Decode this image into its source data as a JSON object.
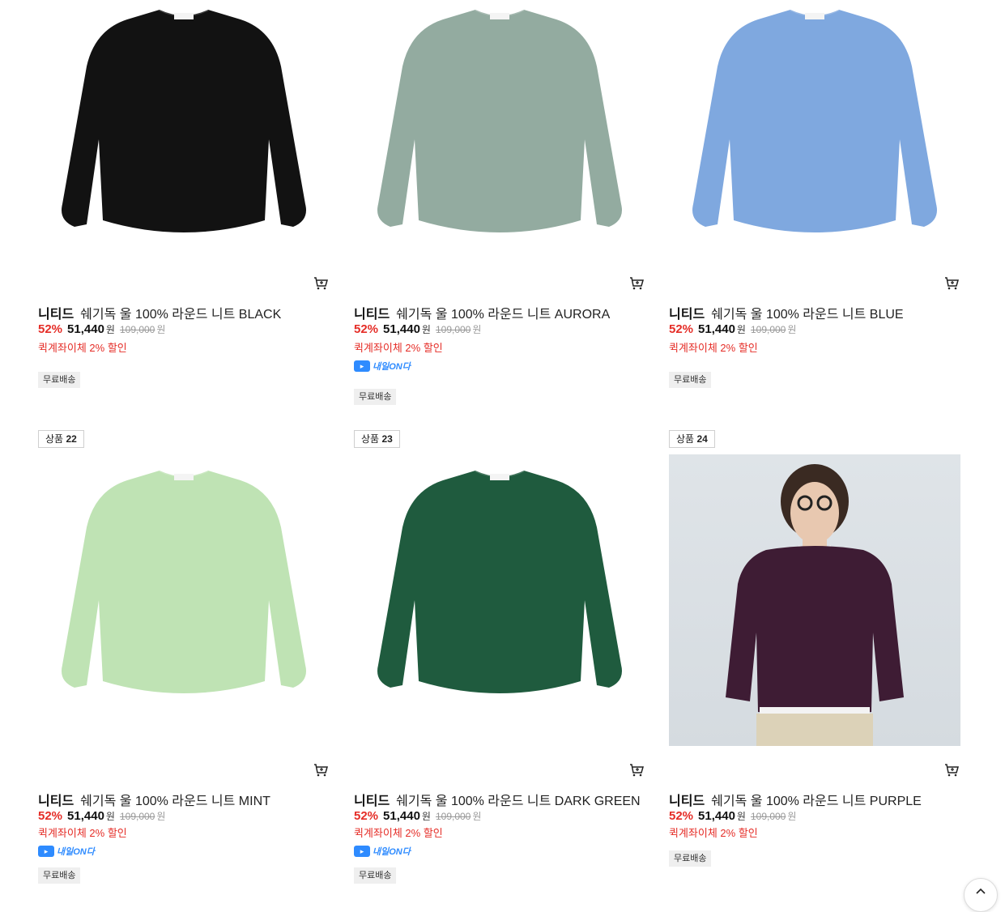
{
  "top_button": {
    "icon": "arrow-up-icon"
  },
  "products": [
    {
      "brand": "니티드",
      "name": "쉐기독 울 100% 라운드 니트 BLACK",
      "discount": "52%",
      "price": "51,440",
      "currency": "원",
      "original_price": "109,000",
      "promo": "퀵계좌이체 2% 할인",
      "badges": [
        "무료배송"
      ],
      "naeil": false,
      "tag": null,
      "sweater_color": "#121212",
      "cart_icon": "cart-icon"
    },
    {
      "brand": "니티드",
      "name": "쉐기독 울 100% 라운드 니트 AURORA",
      "discount": "52%",
      "price": "51,440",
      "currency": "원",
      "original_price": "109,000",
      "promo": "퀵계좌이체 2% 할인",
      "badges": [
        "무료배송"
      ],
      "naeil": true,
      "naeil_label": "내일ON다",
      "tag": null,
      "sweater_color": "#93aba0",
      "cart_icon": "cart-icon"
    },
    {
      "brand": "니티드",
      "name": "쉐기독 울 100% 라운드 니트 BLUE",
      "discount": "52%",
      "price": "51,440",
      "currency": "원",
      "original_price": "109,000",
      "promo": "퀵계좌이체 2% 할인",
      "badges": [
        "무료배송"
      ],
      "naeil": false,
      "tag": null,
      "sweater_color": "#7fa8df",
      "cart_icon": "cart-icon"
    },
    {
      "brand": "니티드",
      "name": "쉐기독 울 100% 라운드 니트 MINT",
      "discount": "52%",
      "price": "51,440",
      "currency": "원",
      "original_price": "109,000",
      "promo": "퀵계좌이체 2% 할인",
      "badges": [
        "무료배송"
      ],
      "naeil": true,
      "naeil_label": "내일ON다",
      "tag_label": "상품",
      "tag_num": "22",
      "sweater_color": "#bfe3b4",
      "cart_icon": "cart-icon"
    },
    {
      "brand": "니티드",
      "name": "쉐기독 울 100% 라운드 니트 DARK GREEN",
      "discount": "52%",
      "price": "51,440",
      "currency": "원",
      "original_price": "109,000",
      "promo": "퀵계좌이체 2% 할인",
      "badges": [
        "무료배송"
      ],
      "naeil": true,
      "naeil_label": "내일ON다",
      "tag_label": "상품",
      "tag_num": "23",
      "sweater_color": "#1f5b3e",
      "cart_icon": "cart-icon"
    },
    {
      "brand": "니티드",
      "name": "쉐기독 울 100% 라운드 니트 PURPLE",
      "discount": "52%",
      "price": "51,440",
      "currency": "원",
      "original_price": "109,000",
      "promo": "퀵계좌이체 2% 할인",
      "badges": [
        "무료배송"
      ],
      "naeil": false,
      "tag_label": "상품",
      "tag_num": "24",
      "sweater_color": "#3e1c34",
      "model_photo": true,
      "cart_icon": "cart-icon"
    }
  ]
}
